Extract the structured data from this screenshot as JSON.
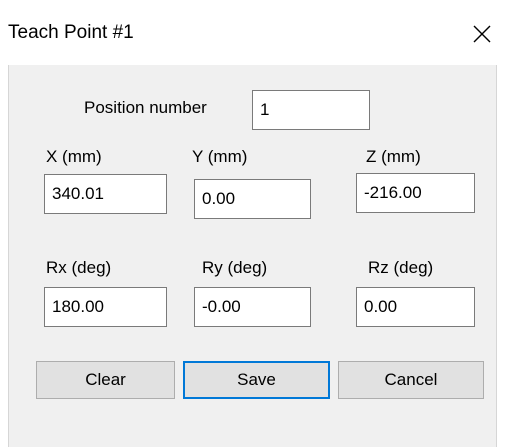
{
  "dialog": {
    "title": "Teach Point #1",
    "close_icon": "close-icon"
  },
  "position": {
    "label": "Position number",
    "value": "1"
  },
  "coordinates": {
    "x": {
      "label": "X (mm)",
      "value": "340.01"
    },
    "y": {
      "label": "Y (mm)",
      "value": "0.00"
    },
    "z": {
      "label": "Z (mm)",
      "value": "-216.00"
    },
    "rx": {
      "label": "Rx (deg)",
      "value": "180.00"
    },
    "ry": {
      "label": "Ry (deg)",
      "value": "-0.00"
    },
    "rz": {
      "label": "Rz (deg)",
      "value": "0.00"
    }
  },
  "buttons": {
    "clear": "Clear",
    "save": "Save",
    "cancel": "Cancel"
  },
  "colors": {
    "client_background": "#f0f0f0",
    "default_button_border": "#0078d7",
    "button_face": "#e1e1e1"
  }
}
